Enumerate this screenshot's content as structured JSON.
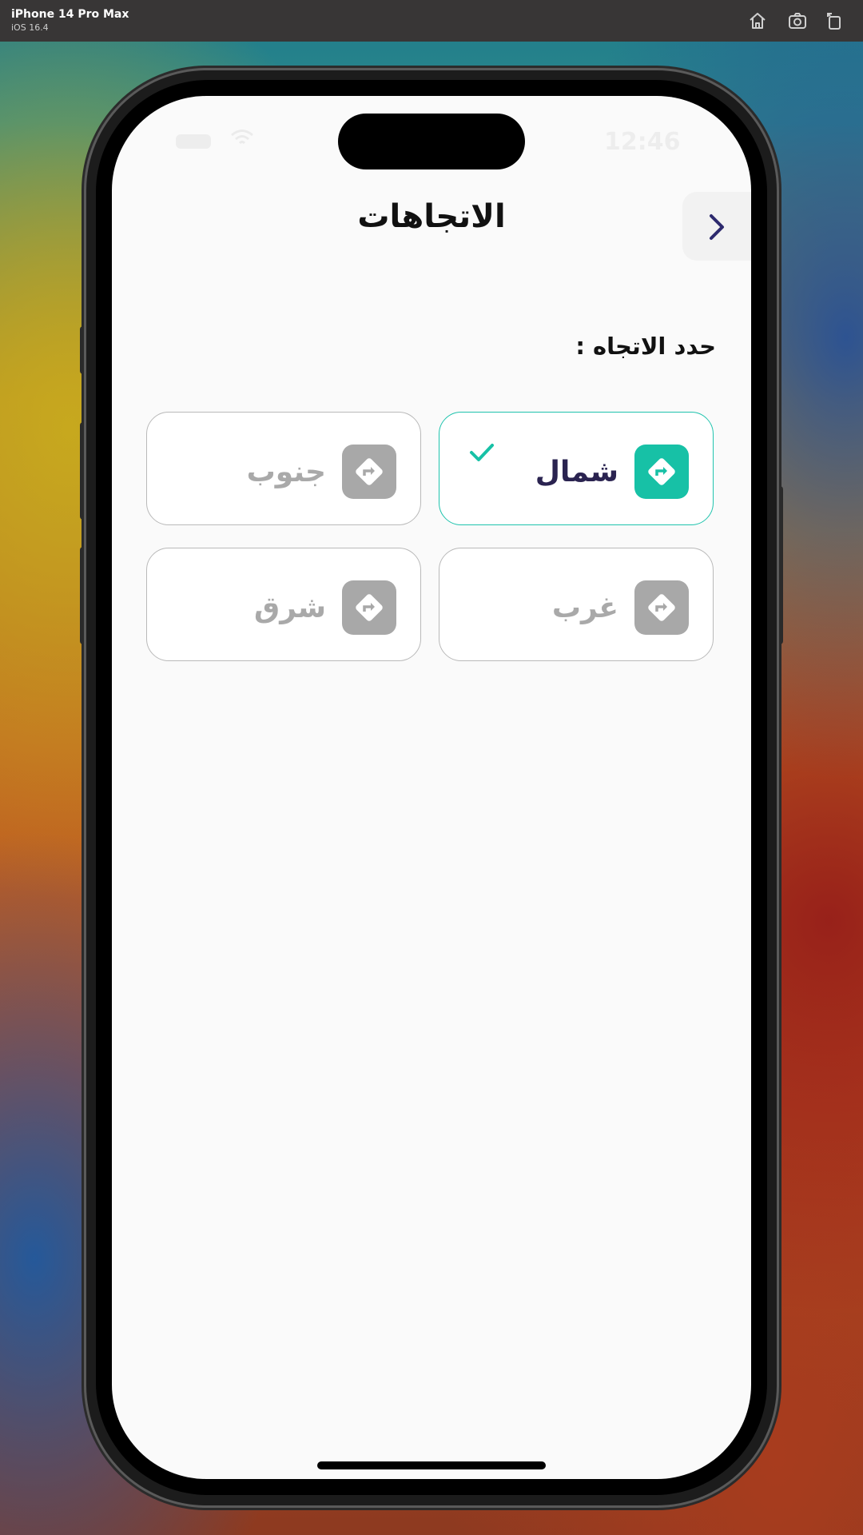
{
  "simulator": {
    "device_name": "iPhone 14 Pro Max",
    "os_version": "iOS 16.4",
    "icons": [
      "home-icon",
      "screenshot-icon",
      "rotate-icon"
    ]
  },
  "status_bar": {
    "time": "12:46"
  },
  "header": {
    "title": "الاتجاهات",
    "back_icon": "chevron-right-icon"
  },
  "section": {
    "label": "حدد الاتجاه  :"
  },
  "directions": [
    {
      "label": "شمال",
      "selected": true,
      "icon": "direction-sign-icon"
    },
    {
      "label": "جنوب",
      "selected": false,
      "icon": "direction-sign-icon"
    },
    {
      "label": "غرب",
      "selected": false,
      "icon": "direction-sign-icon"
    },
    {
      "label": "شرق",
      "selected": false,
      "icon": "direction-sign-icon"
    }
  ],
  "colors": {
    "accent": "#17c1a6",
    "selected_text": "#2a2350",
    "inactive": "#a8a8a8",
    "back_chevron": "#2d2a6e"
  }
}
